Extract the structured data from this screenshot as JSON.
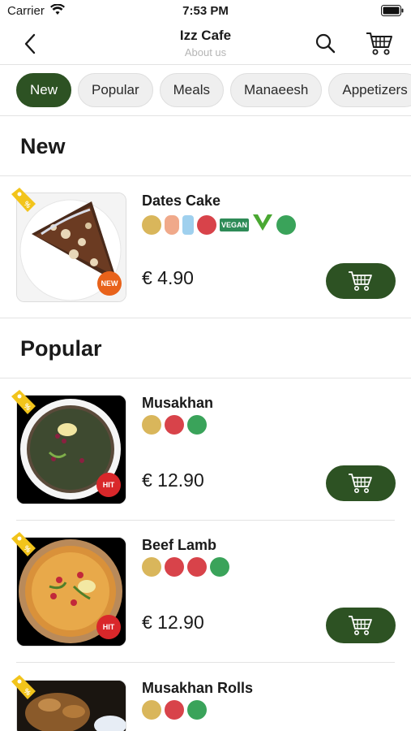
{
  "status_bar": {
    "carrier": "Carrier",
    "time": "7:53 PM"
  },
  "header": {
    "title": "Izz Cafe",
    "subtitle": "About us"
  },
  "categories": [
    {
      "label": "New",
      "active": true
    },
    {
      "label": "Popular",
      "active": false
    },
    {
      "label": "Meals",
      "active": false
    },
    {
      "label": "Manaeesh",
      "active": false
    },
    {
      "label": "Appetizers",
      "active": false
    }
  ],
  "sections": [
    {
      "title": "New",
      "items": [
        {
          "name": "Dates Cake",
          "price": "€ 4.90",
          "badge": "NEW",
          "vegan_label": "VEGAN"
        }
      ]
    },
    {
      "title": "Popular",
      "items": [
        {
          "name": "Musakhan",
          "price": "€ 12.90",
          "badge": "HIT"
        },
        {
          "name": "Beef Lamb",
          "price": "€ 12.90",
          "badge": "HIT"
        },
        {
          "name": "Musakhan Rolls",
          "price": "",
          "badge": ""
        }
      ]
    }
  ],
  "colors": {
    "accent": "#2d5223",
    "badge_new": "#e8621a",
    "badge_hit": "#d9272a",
    "tag": "#f2c41b"
  }
}
